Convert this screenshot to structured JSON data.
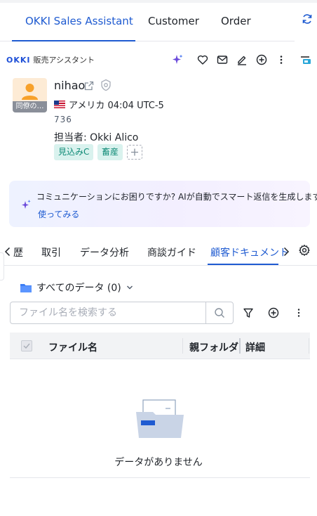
{
  "top_tabs": [
    {
      "label": "OKKI Sales Assistant",
      "active": true
    },
    {
      "label": "Customer",
      "active": false
    },
    {
      "label": "Order",
      "active": false
    }
  ],
  "header": {
    "logo_text": "OKKI",
    "logo_subtitle": "販売アシスタント",
    "icons": [
      "sparkle-icon",
      "heart-icon",
      "mail-icon",
      "edit-icon",
      "plus-circle-icon",
      "more-icon",
      "app-icon"
    ]
  },
  "customer": {
    "avatar_tag": "同僚の…",
    "name": "nihao",
    "country": "アメリカ 04:04 UTC-5",
    "phone": "736",
    "owner": "担当者:  Okki Alico",
    "tags": [
      "見込みC",
      "畜産"
    ]
  },
  "banner": {
    "text": "コミュニケーションにお困りですか? AIが自動でスマート返信を生成します。",
    "link": "使ってみる"
  },
  "tabs2": [
    {
      "label": "歴",
      "active": false
    },
    {
      "label": "取引",
      "active": false
    },
    {
      "label": "データ分析",
      "active": false
    },
    {
      "label": "商談ガイド",
      "active": false
    },
    {
      "label": "顧客ドキュメント",
      "active": true
    }
  ],
  "documents": {
    "folder_label": "すべてのデータ (0)",
    "search_placeholder": "ファイル名を検索する",
    "columns": [
      "ファイル名",
      "親フォルダー",
      "詳細"
    ],
    "empty_text": "データがありません"
  },
  "colors": {
    "accent": "#1f5bd1",
    "tag_bg": "#d9f2ee",
    "tag_text": "#0e8a76",
    "banner_bg": "#f1f0ff"
  }
}
